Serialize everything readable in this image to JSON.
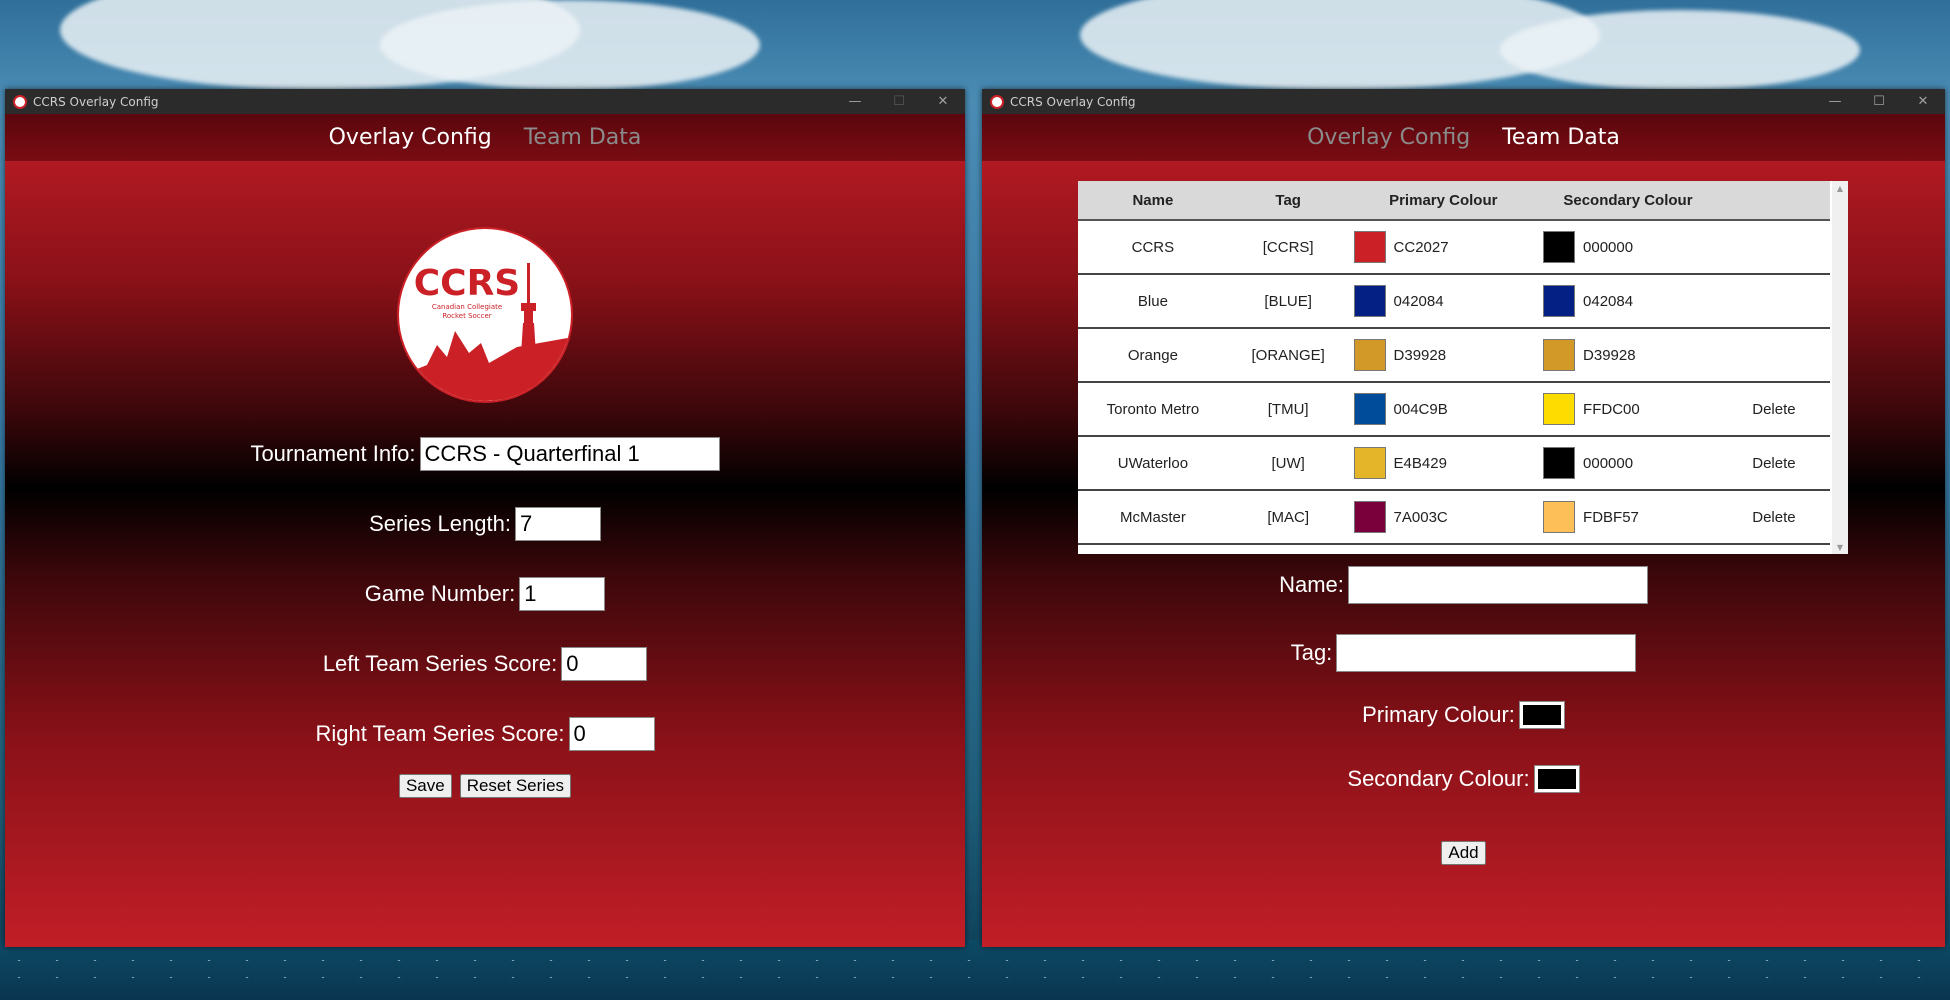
{
  "colors": {
    "brand_red": "#cc2027",
    "nav_active": "#ffffff",
    "nav_inactive": "#8b8b8b"
  },
  "left_window": {
    "title": "CCRS Overlay Config",
    "controls": {
      "minimize": "—",
      "maximize": "☐",
      "close": "✕"
    },
    "tabs": [
      {
        "label": "Overlay Config",
        "active": true
      },
      {
        "label": "Team Data",
        "active": false
      }
    ],
    "logo": {
      "title": "CCRS",
      "line1": "Canadian Collegiate",
      "line2": "Rocket Soccer"
    },
    "fields": {
      "tournament_info": {
        "label": "Tournament Info:",
        "value": "CCRS - Quarterfinal 1"
      },
      "series_length": {
        "label": "Series Length:",
        "value": "7"
      },
      "game_number": {
        "label": "Game Number:",
        "value": "1"
      },
      "left_score": {
        "label": "Left Team Series Score:",
        "value": "0"
      },
      "right_score": {
        "label": "Right Team Series Score:",
        "value": "0"
      }
    },
    "buttons": {
      "save": "Save",
      "reset": "Reset Series"
    }
  },
  "right_window": {
    "title": "CCRS Overlay Config",
    "controls": {
      "minimize": "—",
      "maximize": "☐",
      "close": "✕"
    },
    "tabs": [
      {
        "label": "Overlay Config",
        "active": false
      },
      {
        "label": "Team Data",
        "active": true
      }
    ],
    "table": {
      "headers": [
        "Name",
        "Tag",
        "Primary Colour",
        "Secondary Colour",
        ""
      ],
      "rows": [
        {
          "name": "CCRS",
          "tag": "[CCRS]",
          "primary": "CC2027",
          "secondary": "000000",
          "action": ""
        },
        {
          "name": "Blue",
          "tag": "[BLUE]",
          "primary": "042084",
          "secondary": "042084",
          "action": ""
        },
        {
          "name": "Orange",
          "tag": "[ORANGE]",
          "primary": "D39928",
          "secondary": "D39928",
          "action": ""
        },
        {
          "name": "Toronto Metro",
          "tag": "[TMU]",
          "primary": "004C9B",
          "secondary": "FFDC00",
          "action": "Delete"
        },
        {
          "name": "UWaterloo",
          "tag": "[UW]",
          "primary": "E4B429",
          "secondary": "000000",
          "action": "Delete"
        },
        {
          "name": "McMaster",
          "tag": "[MAC]",
          "primary": "7A003C",
          "secondary": "FDBF57",
          "action": "Delete"
        }
      ]
    },
    "form": {
      "name": {
        "label": "Name:",
        "value": ""
      },
      "tag": {
        "label": "Tag:",
        "value": ""
      },
      "primary": {
        "label": "Primary Colour:",
        "value": "#000000"
      },
      "secondary": {
        "label": "Secondary Colour:",
        "value": "#000000"
      },
      "add": "Add"
    }
  }
}
